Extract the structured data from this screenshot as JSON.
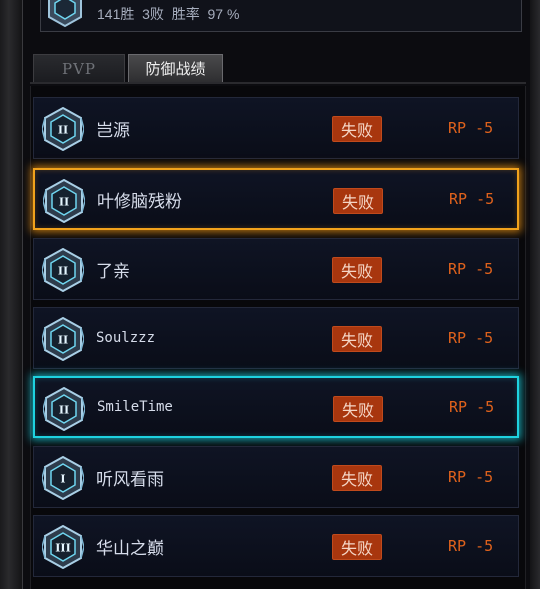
{
  "summary": {
    "text": "141胜  3败  胜率  97 %"
  },
  "tabs": [
    {
      "label": "PVP",
      "active": false
    },
    {
      "label": "防御战绩",
      "active": true
    }
  ],
  "records": [
    {
      "name": "岂源",
      "result": "失败",
      "rp": "RP -5",
      "rank": "II",
      "highlight": "none"
    },
    {
      "name": "叶修脑残粉",
      "result": "失败",
      "rp": "RP -5",
      "rank": "II",
      "highlight": "gold"
    },
    {
      "name": "了亲",
      "result": "失败",
      "rp": "RP -5",
      "rank": "II",
      "highlight": "none"
    },
    {
      "name": "Soulzzz",
      "result": "失败",
      "rp": "RP -5",
      "rank": "II",
      "highlight": "none"
    },
    {
      "name": "SmileTime",
      "result": "失败",
      "rp": "RP -5",
      "rank": "II",
      "highlight": "cyan"
    },
    {
      "name": "听风看雨",
      "result": "失败",
      "rp": "RP -5",
      "rank": "I",
      "highlight": "none"
    },
    {
      "name": "华山之巅",
      "result": "失败",
      "rp": "RP -5",
      "rank": "III",
      "highlight": "none"
    }
  ],
  "colors": {
    "result_bg": "#a8360e",
    "rp_text": "#e0621c",
    "gold_highlight": "#f1a21c",
    "cyan_highlight": "#1ed2e0"
  }
}
